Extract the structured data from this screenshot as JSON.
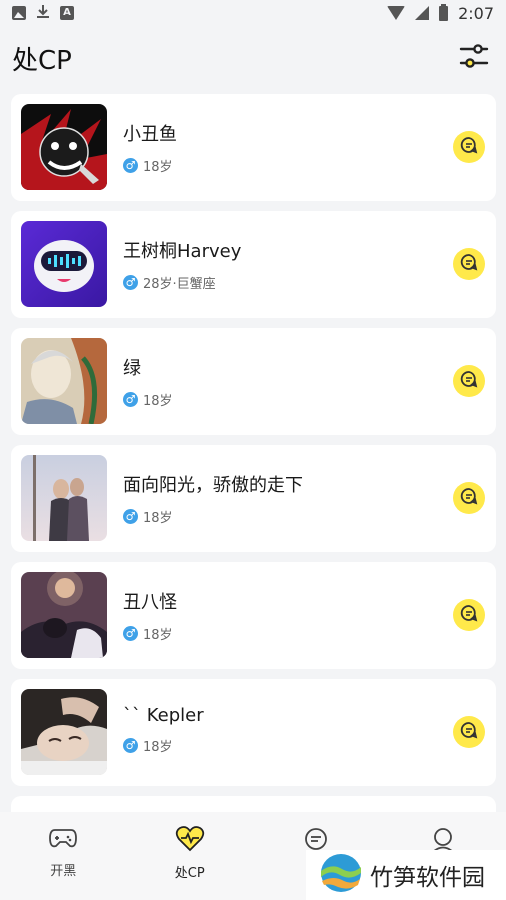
{
  "status_bar": {
    "time": "2:07",
    "icons": [
      "image-icon",
      "download-icon",
      "a-icon",
      "wifi-icon",
      "cell-signal-icon",
      "battery-icon"
    ]
  },
  "header": {
    "title": "处CP",
    "filter_icon": "filter-sliders-icon"
  },
  "users": [
    {
      "name": "小丑鱼",
      "gender_symbol": "♂",
      "meta": "18岁",
      "avatar_theme": "red-black-clown"
    },
    {
      "name": "王树桐Harvey",
      "gender_symbol": "♂",
      "meta": "28岁·巨蟹座",
      "avatar_theme": "purple-robot"
    },
    {
      "name": "绿",
      "gender_symbol": "♂",
      "meta": "18岁",
      "avatar_theme": "sketch-portrait"
    },
    {
      "name": "面向阳光，骄傲的走下",
      "gender_symbol": "♂",
      "meta": "18岁",
      "avatar_theme": "couple-snow"
    },
    {
      "name": "丑八怪",
      "gender_symbol": "♂",
      "meta": "18岁",
      "avatar_theme": "dark-couple"
    },
    {
      "name": "`` Kepler",
      "gender_symbol": "♂",
      "meta": "18岁",
      "avatar_theme": "sleeping-face"
    }
  ],
  "bottom_nav": [
    {
      "label": "开黑",
      "icon": "gamepad-icon",
      "active": false
    },
    {
      "label": "处CP",
      "icon": "heart-pulse-icon",
      "active": true
    },
    {
      "label": "",
      "icon": "chat-icon",
      "active": false
    },
    {
      "label": "",
      "icon": "profile-icon",
      "active": false
    }
  ],
  "watermark": {
    "text": "竹笋软件园"
  },
  "colors": {
    "accent_yellow": "#ffe94a",
    "male_blue": "#3fa1e8",
    "background": "#f3f4f6"
  }
}
